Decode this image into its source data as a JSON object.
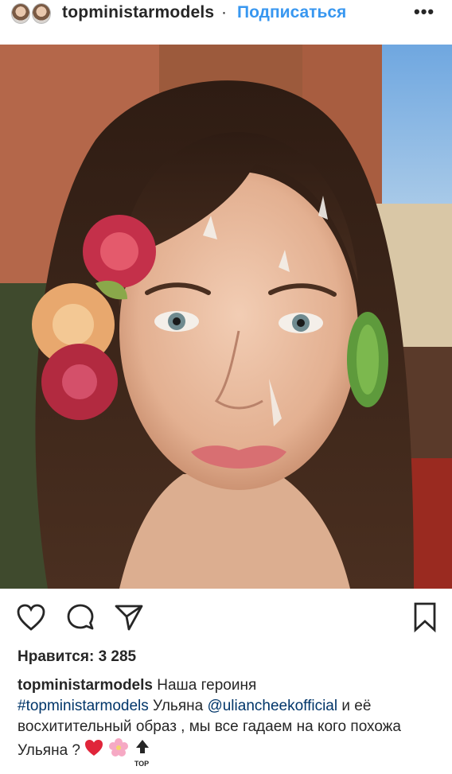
{
  "header": {
    "username": "topministarmodels",
    "separator": "·",
    "follow_label": "Подписаться",
    "more_label": "•••"
  },
  "icons": {
    "like": "heart-icon",
    "comment": "comment-icon",
    "share": "paper-plane-icon",
    "save": "bookmark-icon"
  },
  "likes": {
    "text": "Нравится: 3 285"
  },
  "caption": {
    "username": "topministarmodels",
    "text1": "Наша героиня",
    "hashtag": "#topministarmodels",
    "text2": "Ульяна",
    "mention": "@uliancheekofficial",
    "text3": "и её восхитительный образ , мы все гадаем на кого похожа Ульяна ?",
    "emoji_badge": "TOP"
  },
  "colors": {
    "link_blue": "#3897f0",
    "hashtag_blue": "#003569",
    "text": "#262626"
  }
}
